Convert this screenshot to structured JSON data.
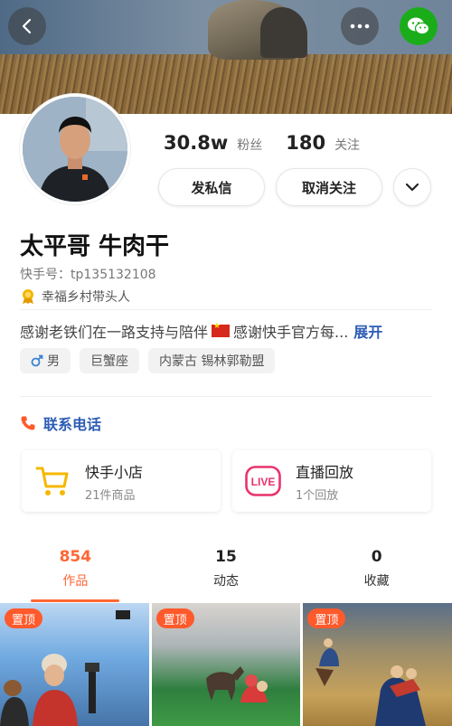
{
  "header": {
    "back_icon": "chevron-left-icon",
    "more_icon": "ellipsis-icon",
    "share_icon": "wechat-icon"
  },
  "profile": {
    "followers_count": "30.8w",
    "followers_label": "粉丝",
    "following_count": "180",
    "following_label": "关注",
    "message_button": "发私信",
    "unfollow_button": "取消关注",
    "name": "太平哥 牛肉干",
    "kuaishou_id": "快手号：tp135132108",
    "title_badge": "幸福乡村带头人",
    "bio": "感谢老铁们在一路支持与陪伴",
    "bio_tail": "感谢快手官方每...",
    "expand_label": "展开",
    "tags": [
      "男",
      "巨蟹座",
      "内蒙古 锡林郭勒盟"
    ]
  },
  "contact": {
    "phone_label": "联系电话"
  },
  "services": {
    "shop": {
      "title": "快手小店",
      "subtitle": "21件商品"
    },
    "live": {
      "title": "直播回放",
      "subtitle": "1个回放",
      "icon_text": "LIVE"
    }
  },
  "tabs": [
    {
      "count": "854",
      "label": "作品"
    },
    {
      "count": "15",
      "label": "动态"
    },
    {
      "count": "0",
      "label": "收藏"
    }
  ],
  "grid": {
    "pin_label": "置顶"
  },
  "colors": {
    "accent": "#ff6633",
    "link": "#2c5cb4",
    "wechat": "#1aad19"
  }
}
